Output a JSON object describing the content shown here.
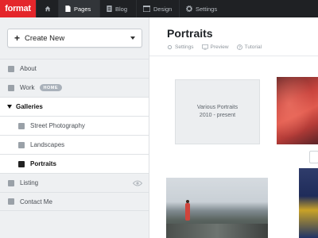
{
  "app": {
    "brand": "format"
  },
  "nav": {
    "items": [
      {
        "label": "",
        "icon": "home-icon"
      },
      {
        "label": "Pages",
        "icon": "page-icon",
        "active": true
      },
      {
        "label": "Blog",
        "icon": "blog-icon"
      },
      {
        "label": "Design",
        "icon": "design-icon"
      },
      {
        "label": "Settings",
        "icon": "gear-icon"
      }
    ]
  },
  "sidebar": {
    "create_label": "Create New",
    "items": [
      {
        "label": "About",
        "icon": "text-page-icon"
      },
      {
        "label": "Work",
        "icon": "image-page-icon",
        "badge": "HOME"
      },
      {
        "label": "Galleries",
        "expanded": true
      },
      {
        "label": "Street Photography",
        "icon": "image-page-icon"
      },
      {
        "label": "Landscapes",
        "icon": "image-page-icon"
      },
      {
        "label": "Portraits",
        "icon": "image-page-icon",
        "active": true
      },
      {
        "label": "Listing",
        "icon": "grid-icon",
        "hidden_icon": "eye-icon"
      },
      {
        "label": "Contact Me",
        "icon": "page-icon"
      }
    ]
  },
  "main": {
    "title": "Portraits",
    "tabs": [
      {
        "label": "Settings",
        "icon": "gear-icon"
      },
      {
        "label": "Preview",
        "icon": "monitor-icon"
      },
      {
        "label": "Tutorial",
        "icon": "help-icon"
      }
    ],
    "placeholder": {
      "line1": "Various Portraits",
      "line2": "2010 - present"
    }
  },
  "colors": {
    "brand_red": "#e4262b",
    "topbar_bg": "#1f2124",
    "sidebar_bg": "#eef0f2",
    "badge_bg": "#a9b1ba"
  }
}
